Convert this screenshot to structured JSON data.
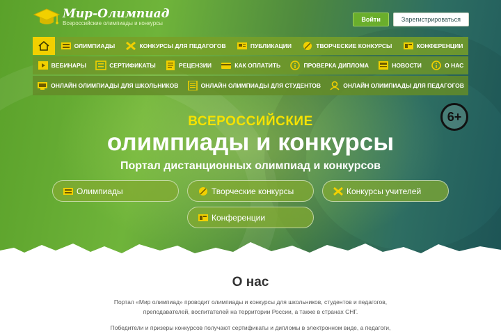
{
  "logo": {
    "title": "Мир-Олимпиад",
    "subtitle": "Всероссийские олимпиады и конкурсы"
  },
  "auth": {
    "login": "Войти",
    "register": "Зарегистрироваться"
  },
  "menu": {
    "row1": [
      "ОЛИМПИАДЫ",
      "КОНКУРСЫ ДЛЯ ПЕДАГОГОВ",
      "ПУБЛИКАЦИИ",
      "ТВОРЧЕСКИЕ КОНКУРСЫ",
      "КОНФЕРЕНЦИИ"
    ],
    "row2": [
      "ВЕБИНАРЫ",
      "СЕРТИФИКАТЫ",
      "РЕЦЕНЗИИ",
      "КАК ОПЛАТИТЬ",
      "ПРОВЕРКА ДИПЛОМА",
      "НОВОСТИ",
      "О НАС"
    ],
    "row3": [
      "ОНЛАЙН ОЛИМПИАДЫ ДЛЯ ШКОЛЬНИКОВ",
      "ОНЛАЙН ОЛИМПИАДЫ ДЛЯ СТУДЕНТОВ",
      "ОНЛАЙН ОЛИМПИАДЫ ДЛЯ ПЕДАГОГОВ"
    ]
  },
  "hero": {
    "subtitle": "ВСЕРОССИЙСКИЕ",
    "title": "олимпиады и конкурсы",
    "tagline": "Портал дистанционных олимпиад и конкурсов",
    "age": "6+",
    "buttons": [
      "Олимпиады",
      "Творческие конкурсы",
      "Конкурсы учителей",
      "Конференции"
    ]
  },
  "about": {
    "title": "О нас",
    "p1": "Портал «Мир олимпиад» проводит олимпиады и конкурсы для школьников, студентов и педагогов, преподавателей, воспитателей на территории России, а также в странах СНГ.",
    "p2": "Победители и призеры конкурсов получают сертификаты и дипломы в электронном виде, а педагоги,"
  },
  "colors": {
    "accent_yellow": "#f6e200",
    "menu_green": "#7aa028",
    "login_green": "#6aae2c"
  }
}
